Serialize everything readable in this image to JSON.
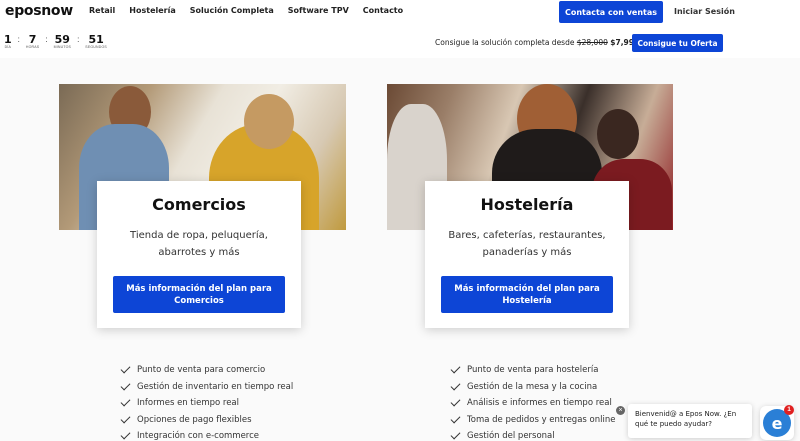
{
  "header": {
    "logo_text": "eposnow",
    "nav": [
      "Retail",
      "Hostelería",
      "Solución Completa",
      "Software TPV",
      "Contacto"
    ],
    "contact_button": "Contacta con ventas",
    "login_link": "Iniciar Sesión"
  },
  "countdown": {
    "units": [
      {
        "value": "1",
        "label": "DÍA"
      },
      {
        "value": "7",
        "label": "HORAS"
      },
      {
        "value": "59",
        "label": "MINUTOS"
      },
      {
        "value": "51",
        "label": "SEGUNDOS"
      }
    ],
    "separator": ":"
  },
  "offer": {
    "text": "Consigue la solución completa desde",
    "old_price": "$28,000",
    "new_price": "$7,999",
    "button": "Consigue tu Oferta"
  },
  "cards": [
    {
      "title": "Comercios",
      "description": "Tienda de ropa, peluquería, abarrotes y más",
      "cta": "Más información del plan para Comercios",
      "features": [
        "Punto de venta para comercio",
        "Gestión de inventario en tiempo real",
        "Informes en tiempo real",
        "Opciones de pago flexibles",
        "Integración con e-commerce"
      ]
    },
    {
      "title": "Hostelería",
      "description": "Bares, cafeterías, restaurantes, panaderías y más",
      "cta": "Más información del plan para Hostelería",
      "features": [
        "Punto de venta para hostelería",
        "Gestión de la mesa y la cocina",
        "Análisis e informes en tiempo real",
        "Toma de pedidos y entregas online",
        "Gestión del personal"
      ]
    }
  ],
  "chat": {
    "message": "Bienvenid@ a Epos Now. ¿En qué te puedo ayudar?",
    "badge_count": "1",
    "launcher_letter": "e",
    "close_symbol": "×"
  },
  "colors": {
    "brand_blue": "#0d45d6",
    "badge_red": "#e02020"
  }
}
